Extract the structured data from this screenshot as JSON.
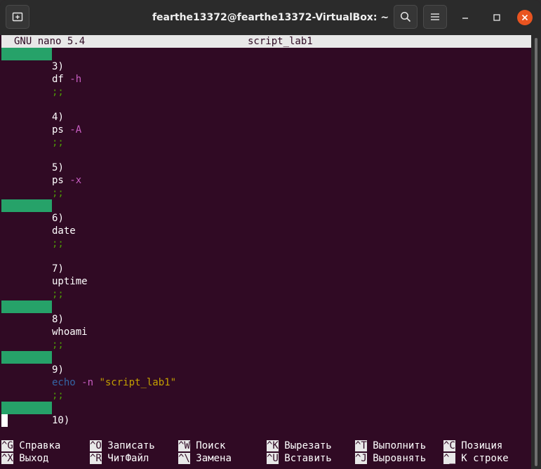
{
  "window": {
    "title": "fearthe13372@fearthe13372-VirtualBox: ~"
  },
  "nano": {
    "version": "GNU nano 5.4",
    "filename": "script_lab1"
  },
  "code": {
    "c3": "3",
    "df": "df",
    "df_flag": "-h",
    "c4": "4",
    "ps1": "ps",
    "ps1_flag": "-A",
    "c5": "5",
    "ps2": "ps",
    "ps2_flag": "-x",
    "c6": "6",
    "date": "date",
    "c7": "7",
    "uptime": "uptime",
    "c8": "8",
    "whoami": "whoami",
    "c9": "9",
    "echo": "echo",
    "echo_flag": "-n",
    "echo_str": "\"script_lab1\"",
    "c10": "10",
    "paren": ")",
    "semi": ";;"
  },
  "shortcuts": [
    {
      "key": "^G",
      "label": "Справка"
    },
    {
      "key": "^O",
      "label": "Записать"
    },
    {
      "key": "^W",
      "label": "Поиск"
    },
    {
      "key": "^K",
      "label": "Вырезать"
    },
    {
      "key": "^T",
      "label": "Выполнить"
    },
    {
      "key": "^C",
      "label": "Позиция"
    },
    {
      "key": "^X",
      "label": "Выход"
    },
    {
      "key": "^R",
      "label": "ЧитФайл"
    },
    {
      "key": "^\\",
      "label": "Замена"
    },
    {
      "key": "^U",
      "label": "Вставить"
    },
    {
      "key": "^J",
      "label": "Выровнять"
    },
    {
      "key": "^_",
      "label": "К строке"
    }
  ],
  "colors": {
    "terminal_bg": "#300a24",
    "titlebar_bg": "#2b2b2b",
    "close_button": "#e95420",
    "marker_green": "#26a269",
    "flag_magenta": "#c95ec3",
    "semicolon_green": "#4e9a06",
    "keyword_blue": "#3465a4",
    "string_yellow": "#c4a000"
  },
  "icons": {
    "new_tab": "new-tab-icon",
    "search": "search-icon",
    "menu": "hamburger-menu-icon",
    "minimize": "minimize-icon",
    "maximize": "maximize-icon",
    "close": "close-icon"
  }
}
